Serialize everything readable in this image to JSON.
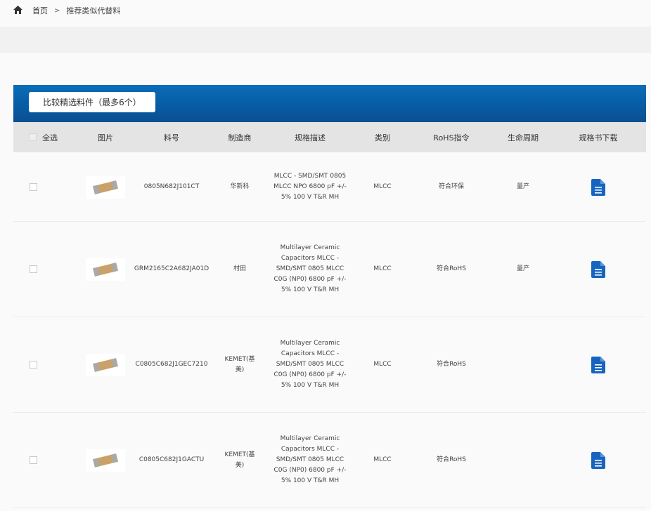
{
  "breadcrumb": {
    "home_icon": "home-icon",
    "home_label": "首页",
    "separator": ">",
    "current": "推荐类似代替料"
  },
  "toolbar": {
    "compare_button": "比较精选料件（最多6个）"
  },
  "table": {
    "headers": {
      "select_all": "全选",
      "image": "图片",
      "part_no": "料号",
      "manufacturer": "制造商",
      "description": "规格描述",
      "category": "类别",
      "rohs": "RoHS指令",
      "lifecycle": "生命周期",
      "datasheet": "规格书下载"
    },
    "rows": [
      {
        "part_no": "0805N682J101CT",
        "manufacturer": "华新科",
        "description": "MLCC - SMD/SMT 0805 MLCC NPO 6800 pF +/- 5% 100 V T&R MH",
        "category": "MLCC",
        "rohs": "符合环保",
        "lifecycle": "量产"
      },
      {
        "part_no": "GRM2165C2A682JA01D",
        "manufacturer": "村田",
        "description": "Multilayer Ceramic Capacitors MLCC - SMD/SMT 0805 MLCC C0G (NP0) 6800 pF +/- 5% 100 V T&R MH",
        "category": "MLCC",
        "rohs": "符合RoHS",
        "lifecycle": "量产"
      },
      {
        "part_no": "C0805C682J1GEC7210",
        "manufacturer": "KEMET(基美)",
        "description": "Multilayer Ceramic Capacitors MLCC - SMD/SMT 0805 MLCC C0G (NP0) 6800 pF +/- 5% 100 V T&R MH",
        "category": "MLCC",
        "rohs": "符合RoHS",
        "lifecycle": ""
      },
      {
        "part_no": "C0805C682J1GACTU",
        "manufacturer": "KEMET(基美)",
        "description": "Multilayer Ceramic Capacitors MLCC - SMD/SMT 0805 MLCC C0G (NP0) 6800 pF +/- 5% 100 V T&R MH",
        "category": "MLCC",
        "rohs": "符合RoHS",
        "lifecycle": ""
      }
    ]
  },
  "colors": {
    "header_blue": "#075fa8",
    "lifecycle_green": "#2faa3d",
    "doc_icon_blue": "#1565c0"
  }
}
